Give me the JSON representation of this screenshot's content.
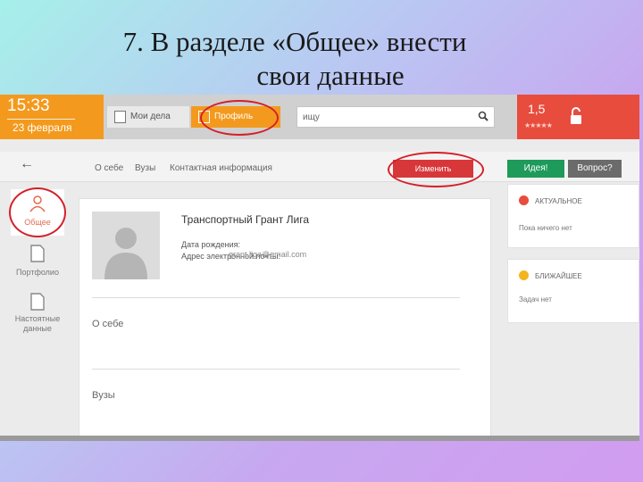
{
  "slide": {
    "title_line1": "7. В разделе «Общее» внести",
    "title_line2": "свои данные"
  },
  "header": {
    "time": "15:33",
    "date": "23 февраля",
    "tabs": [
      {
        "label": "Мои дела",
        "icon": "edit-icon"
      },
      {
        "label": "Профиль",
        "icon": "edit-icon"
      }
    ],
    "search_value": "ищу",
    "rating_value": "1,5",
    "rating_stars": "★★★★★",
    "lock_icon": "unlock-icon"
  },
  "nav": {
    "back_icon": "arrow-left-icon",
    "links": [
      "О себе",
      "Вузы",
      "Контактная информация"
    ],
    "edit_button": "Изменить",
    "idea_button": "Идея!",
    "question_button": "Вопрос?"
  },
  "sidebar": {
    "items": [
      {
        "label": "Общее",
        "icon": "person-icon"
      },
      {
        "label": "Портфолио",
        "icon": "document-icon"
      },
      {
        "label_line1": "Настоятные",
        "label_line2": "данные",
        "icon": "document-icon"
      }
    ]
  },
  "profile": {
    "name": "Транспортный Грант Лига",
    "birth_label": "Дата рождения:",
    "email_label": "Адрес электронной почты:",
    "email_value": "grant.liga@gmail.com",
    "section_about": "О себе",
    "section_universities": "Вузы"
  },
  "panels": {
    "actual_title": "АКТУАЛЬНОЕ",
    "actual_text": "Пока ничего нет",
    "soon_title": "БЛИЖАЙШЕЕ",
    "soon_text": "Задач нет"
  },
  "colors": {
    "accent_orange": "#f39a1e",
    "accent_red": "#e84c3d",
    "button_red": "#d8373a",
    "button_green": "#1e9a5a",
    "annotation": "#d4202a"
  }
}
